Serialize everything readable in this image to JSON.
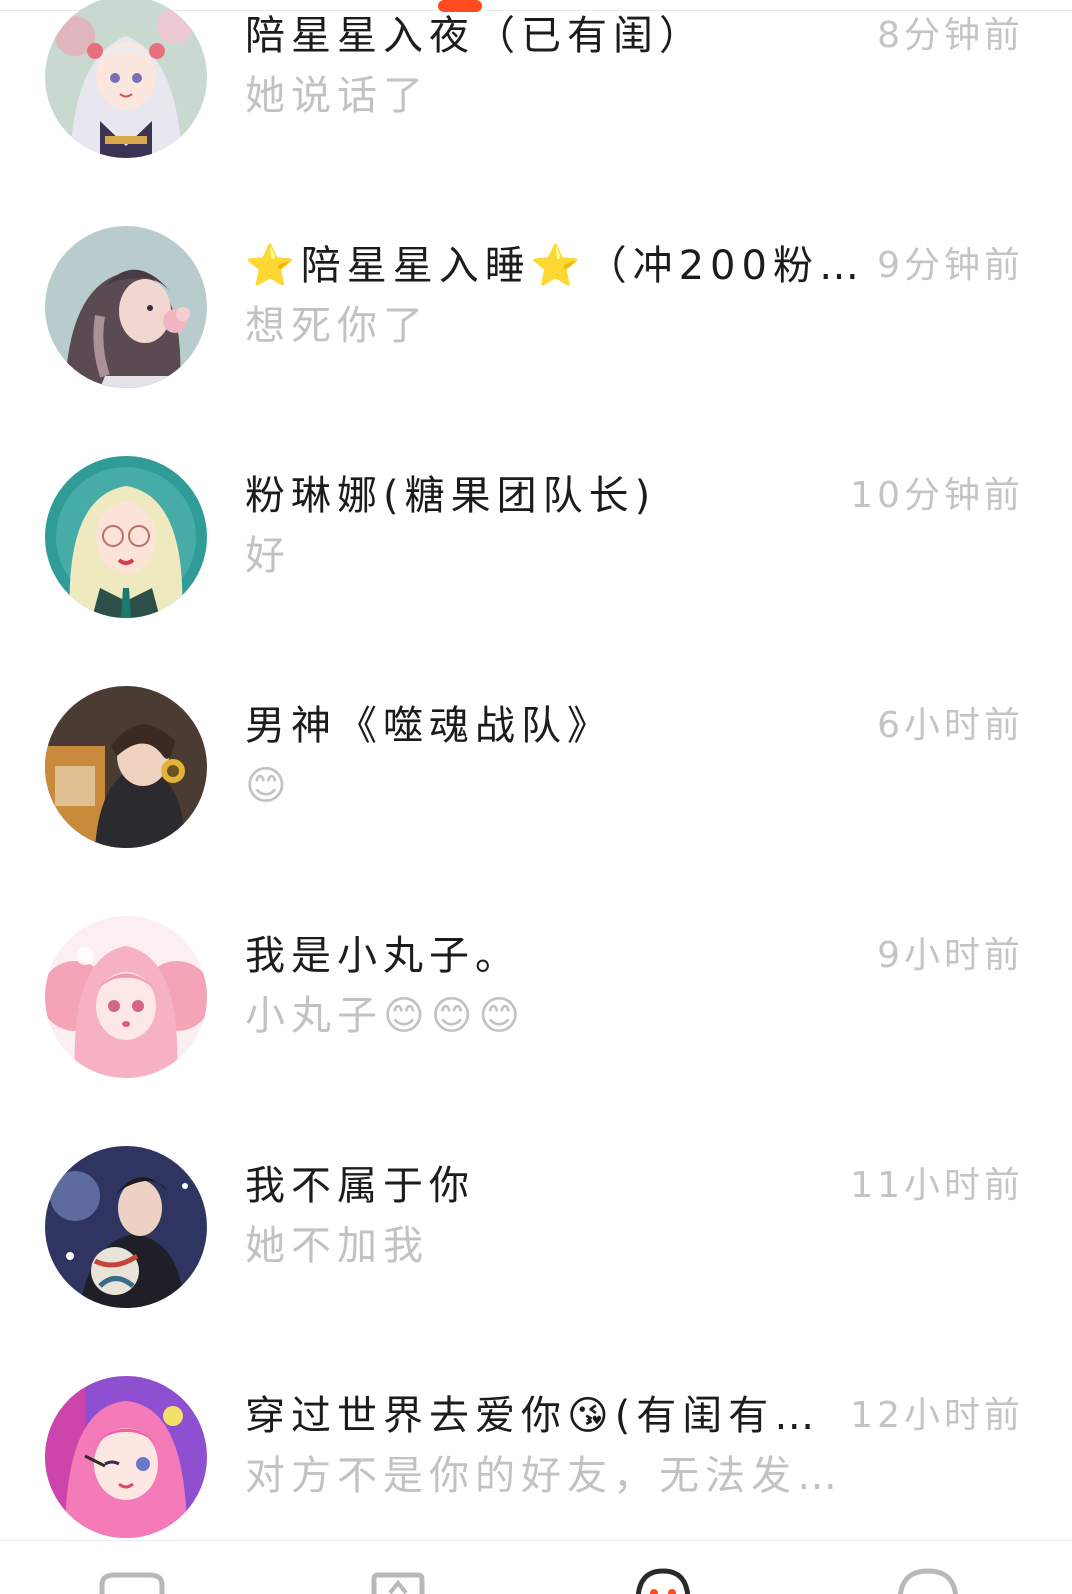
{
  "colors": {
    "accent": "#ff4b1f",
    "name_text": "#1c1c1c",
    "secondary_text": "#c2c2c2",
    "time_text": "#c4c4c4"
  },
  "conversations": [
    {
      "name": "陪星星入夜（已有闺）",
      "time": "8分钟前",
      "preview": "她说话了",
      "avatar_icon": "anime-girl-silver-hair-avatar"
    },
    {
      "name": "⭐陪星星入睡⭐（冲200粉…",
      "time": "9分钟前",
      "preview": "想死你了",
      "avatar_icon": "anime-girl-braid-flower-avatar"
    },
    {
      "name": "粉琳娜(糖果团队长)",
      "time": "10分钟前",
      "preview": "好",
      "avatar_icon": "anime-girl-blonde-glasses-avatar"
    },
    {
      "name": "男神《噬魂战队》",
      "time": "6小时前",
      "preview": "😊",
      "avatar_icon": "anime-boy-headphones-avatar"
    },
    {
      "name": "我是小丸子。",
      "time": "9小时前",
      "preview": "小丸子😊😊😊",
      "avatar_icon": "anime-girl-pink-twintails-avatar"
    },
    {
      "name": "我不属于你",
      "time": "11小时前",
      "preview": "她不加我",
      "avatar_icon": "anime-boy-volleyball-avatar"
    },
    {
      "name": "穿过世界去爱你😘(有闺有…",
      "time": "12小时前",
      "preview": "对方不是你的好友，无法发…",
      "avatar_icon": "anime-girl-pink-wink-avatar"
    }
  ],
  "bottom_nav": [
    {
      "icon": "gamepad-icon"
    },
    {
      "icon": "home-icon"
    },
    {
      "icon": "message-icon",
      "active": true
    },
    {
      "icon": "profile-icon"
    }
  ]
}
